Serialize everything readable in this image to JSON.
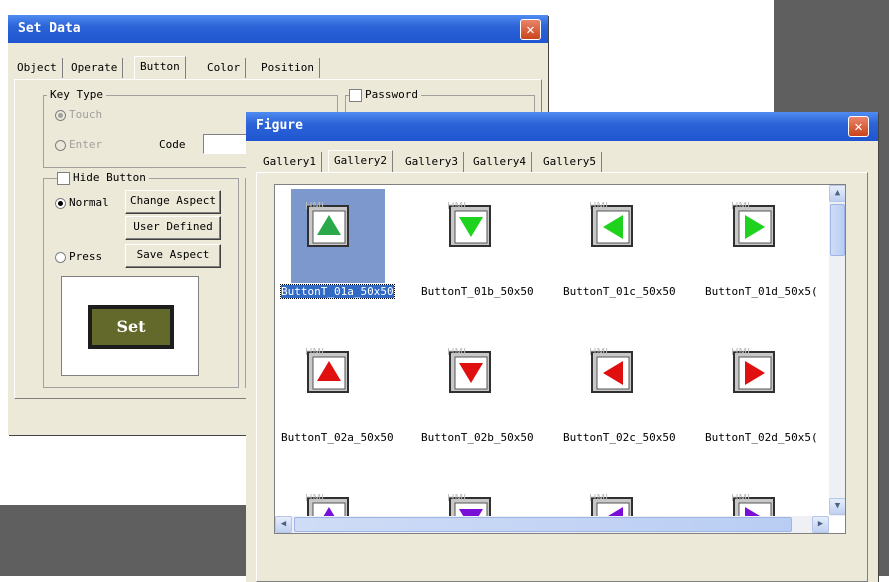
{
  "set_data": {
    "title": "Set Data",
    "close": "✕",
    "tabs": [
      "Object",
      "Operate",
      "Button",
      "Color",
      "Position"
    ],
    "active_tab": "Button",
    "key_type": {
      "label": "Key Type",
      "touch": "Touch",
      "enter": "Enter",
      "code": "Code"
    },
    "password": "Password",
    "hide_button": "Hide Button",
    "normal": "Normal",
    "press": "Press",
    "change_aspect": "Change Aspect",
    "user_defined": "User Defined",
    "save_aspect": "Save Aspect",
    "preview_label": "Set"
  },
  "figure": {
    "title": "Figure",
    "close": "✕",
    "tabs": [
      "Gallery1",
      "Gallery2",
      "Gallery3",
      "Gallery4",
      "Gallery5"
    ],
    "active_tab": "Gallery2",
    "items": [
      {
        "name": "ButtonT_01a_50x50",
        "arrow": "up",
        "color": "#2aa84a",
        "selected": true
      },
      {
        "name": "ButtonT_01b_50x50",
        "arrow": "down",
        "color": "#1ed21e"
      },
      {
        "name": "ButtonT_01c_50x50",
        "arrow": "left",
        "color": "#1ed21e"
      },
      {
        "name": "ButtonT_01d_50x5(",
        "arrow": "right",
        "color": "#1ed21e"
      },
      {
        "name": "ButtonT_02a_50x50",
        "arrow": "up",
        "color": "#e01010"
      },
      {
        "name": "ButtonT_02b_50x50",
        "arrow": "down",
        "color": "#e01010"
      },
      {
        "name": "ButtonT_02c_50x50",
        "arrow": "left",
        "color": "#e01010"
      },
      {
        "name": "ButtonT_02d_50x5(",
        "arrow": "right",
        "color": "#e01010"
      },
      {
        "name": "",
        "arrow": "up",
        "color": "#7a10d8"
      },
      {
        "name": "",
        "arrow": "down",
        "color": "#7a10d8"
      },
      {
        "name": "",
        "arrow": "left",
        "color": "#7a10d8"
      },
      {
        "name": "",
        "arrow": "right",
        "color": "#7a10d8"
      }
    ],
    "watermark": "HMI"
  }
}
